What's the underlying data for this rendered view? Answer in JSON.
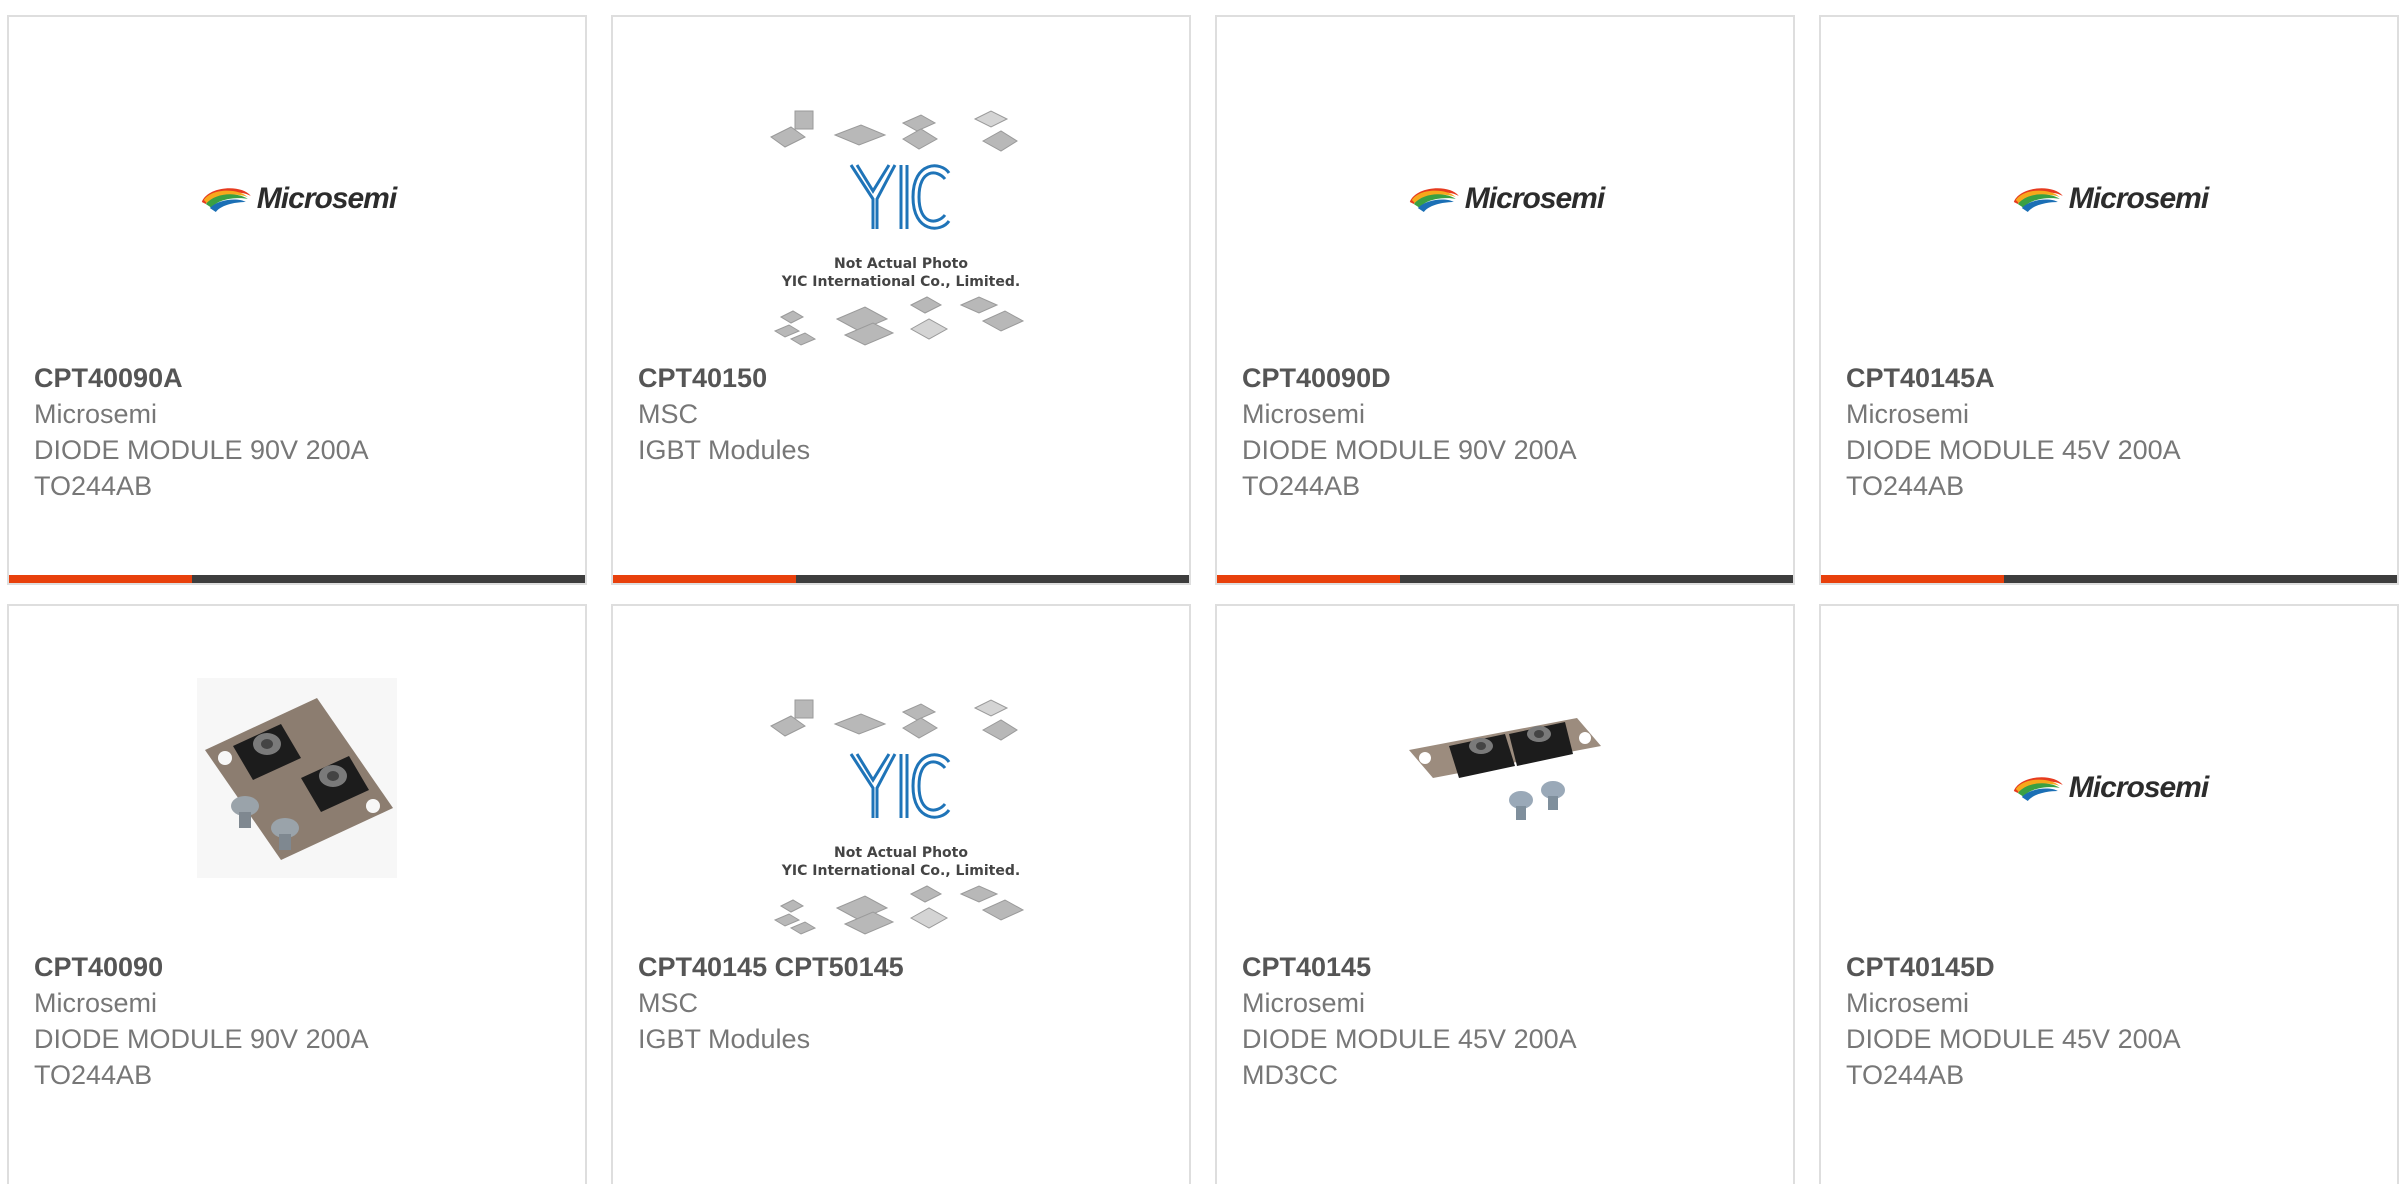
{
  "colors": {
    "accent_bar": "#e8400c",
    "dark_bar": "#3d3d3d",
    "card_border": "#dedede",
    "part_number_text": "#555555",
    "detail_text": "#777777"
  },
  "products": [
    {
      "part_number": "CPT40090A",
      "manufacturer": "Microsemi",
      "description": "DIODE MODULE 90V 200A",
      "package": "TO244AB",
      "image_type": "microsemi-logo",
      "logo_text": "Microsemi",
      "selected": true
    },
    {
      "part_number": "CPT40150",
      "manufacturer": "MSC",
      "description": "IGBT Modules",
      "package": "",
      "image_type": "yic-placeholder",
      "placeholder_lines": [
        "Not Actual Photo",
        "YIC International Co., Limited."
      ],
      "selected": true
    },
    {
      "part_number": "CPT40090D",
      "manufacturer": "Microsemi",
      "description": "DIODE MODULE 90V 200A",
      "package": "TO244AB",
      "image_type": "microsemi-logo",
      "logo_text": "Microsemi",
      "selected": true
    },
    {
      "part_number": "CPT40145A",
      "manufacturer": "Microsemi",
      "description": "DIODE MODULE 45V 200A",
      "package": "TO244AB",
      "image_type": "microsemi-logo",
      "logo_text": "Microsemi",
      "selected": true
    },
    {
      "part_number": "CPT40090",
      "manufacturer": "Microsemi",
      "description": "DIODE MODULE 90V 200A",
      "package": "TO244AB",
      "image_type": "diode-module-photo-large",
      "selected": false
    },
    {
      "part_number": "CPT40145 CPT50145",
      "manufacturer": "MSC",
      "description": "IGBT Modules",
      "package": "",
      "image_type": "yic-placeholder",
      "placeholder_lines": [
        "Not Actual Photo",
        "YIC International Co., Limited."
      ],
      "selected": false
    },
    {
      "part_number": "CPT40145",
      "manufacturer": "Microsemi",
      "description": "DIODE MODULE 45V 200A",
      "package": "MD3CC",
      "image_type": "diode-module-photo-small",
      "selected": false
    },
    {
      "part_number": "CPT40145D",
      "manufacturer": "Microsemi",
      "description": "DIODE MODULE 45V 200A",
      "package": "TO244AB",
      "image_type": "microsemi-logo",
      "logo_text": "Microsemi",
      "selected": false
    }
  ]
}
